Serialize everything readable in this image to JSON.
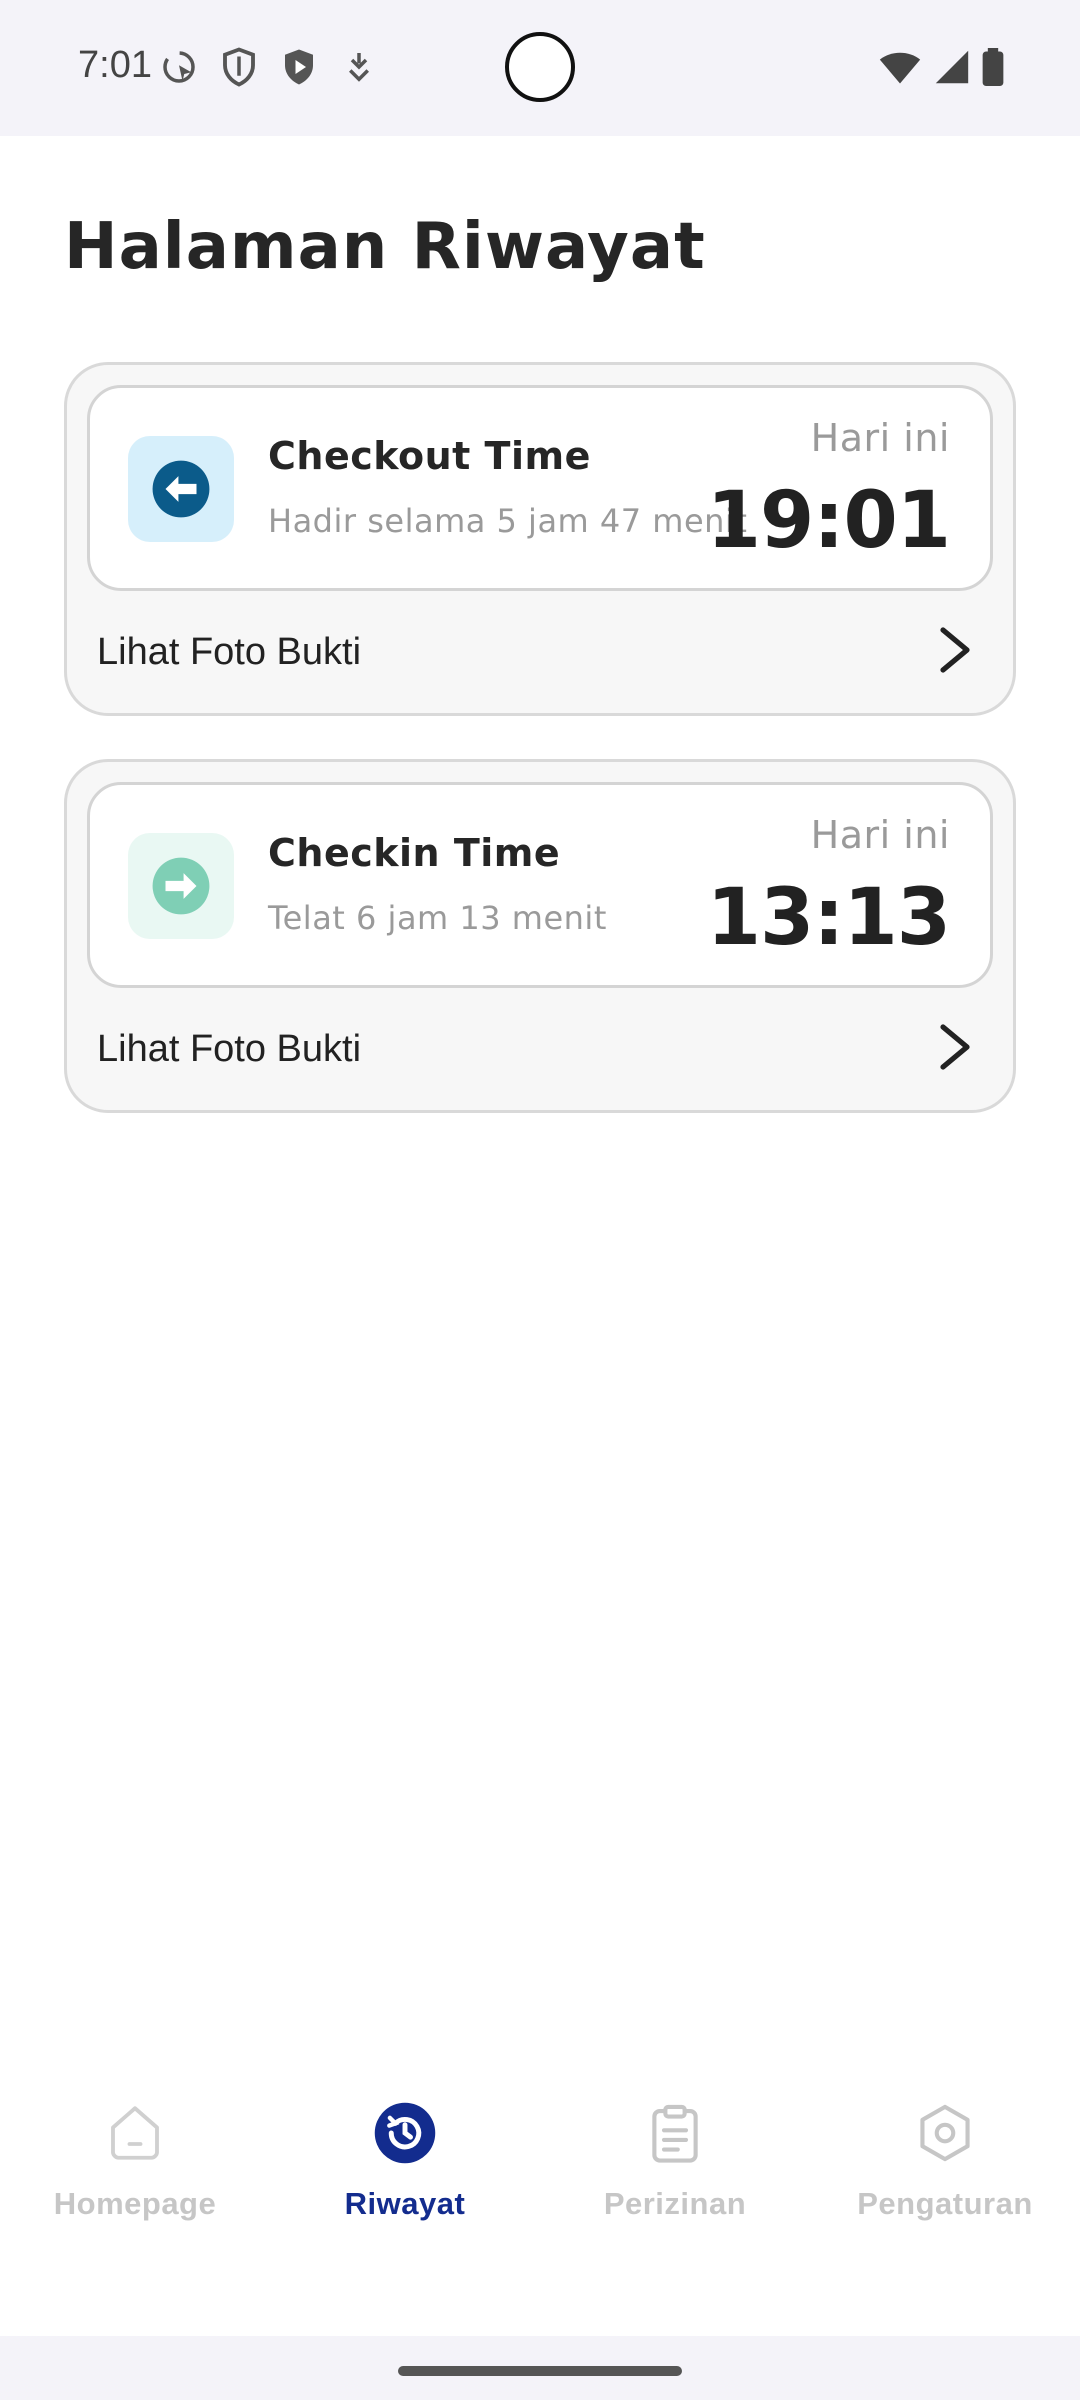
{
  "status_bar": {
    "time": "7:01",
    "left_icons": [
      "cursor-icon",
      "shield-outline-icon",
      "shield-play-icon",
      "download-icon"
    ],
    "right_icons": [
      "wifi-icon",
      "signal-icon",
      "battery-icon"
    ]
  },
  "page": {
    "title": "Halaman Riwayat"
  },
  "records": [
    {
      "title": "Checkout Time",
      "subtitle": "Hadir selama 5 jam 47 menit",
      "day": "Hari ini",
      "time": "19:01",
      "link_label": "Lihat Foto Bukti",
      "icon": "arrow-left-circle-icon",
      "icon_color": "#0b5b8a",
      "icon_bg": "#d6effb"
    },
    {
      "title": "Checkin Time",
      "subtitle": "Telat 6 jam 13 menit",
      "day": "Hari ini",
      "time": "13:13",
      "link_label": "Lihat Foto Bukti",
      "icon": "arrow-right-circle-icon",
      "icon_color": "#7fcfb5",
      "icon_bg": "#e9f8f3"
    }
  ],
  "nav": {
    "items": [
      {
        "label": "Homepage",
        "icon": "home-icon",
        "active": false
      },
      {
        "label": "Riwayat",
        "icon": "history-icon",
        "active": true
      },
      {
        "label": "Perizinan",
        "icon": "clipboard-icon",
        "active": false
      },
      {
        "label": "Pengaturan",
        "icon": "settings-icon",
        "active": false
      }
    ]
  },
  "colors": {
    "accent": "#132c8e",
    "inactive": "#c6c6c6",
    "text_primary": "#262626",
    "text_secondary": "#9a9a9a"
  }
}
